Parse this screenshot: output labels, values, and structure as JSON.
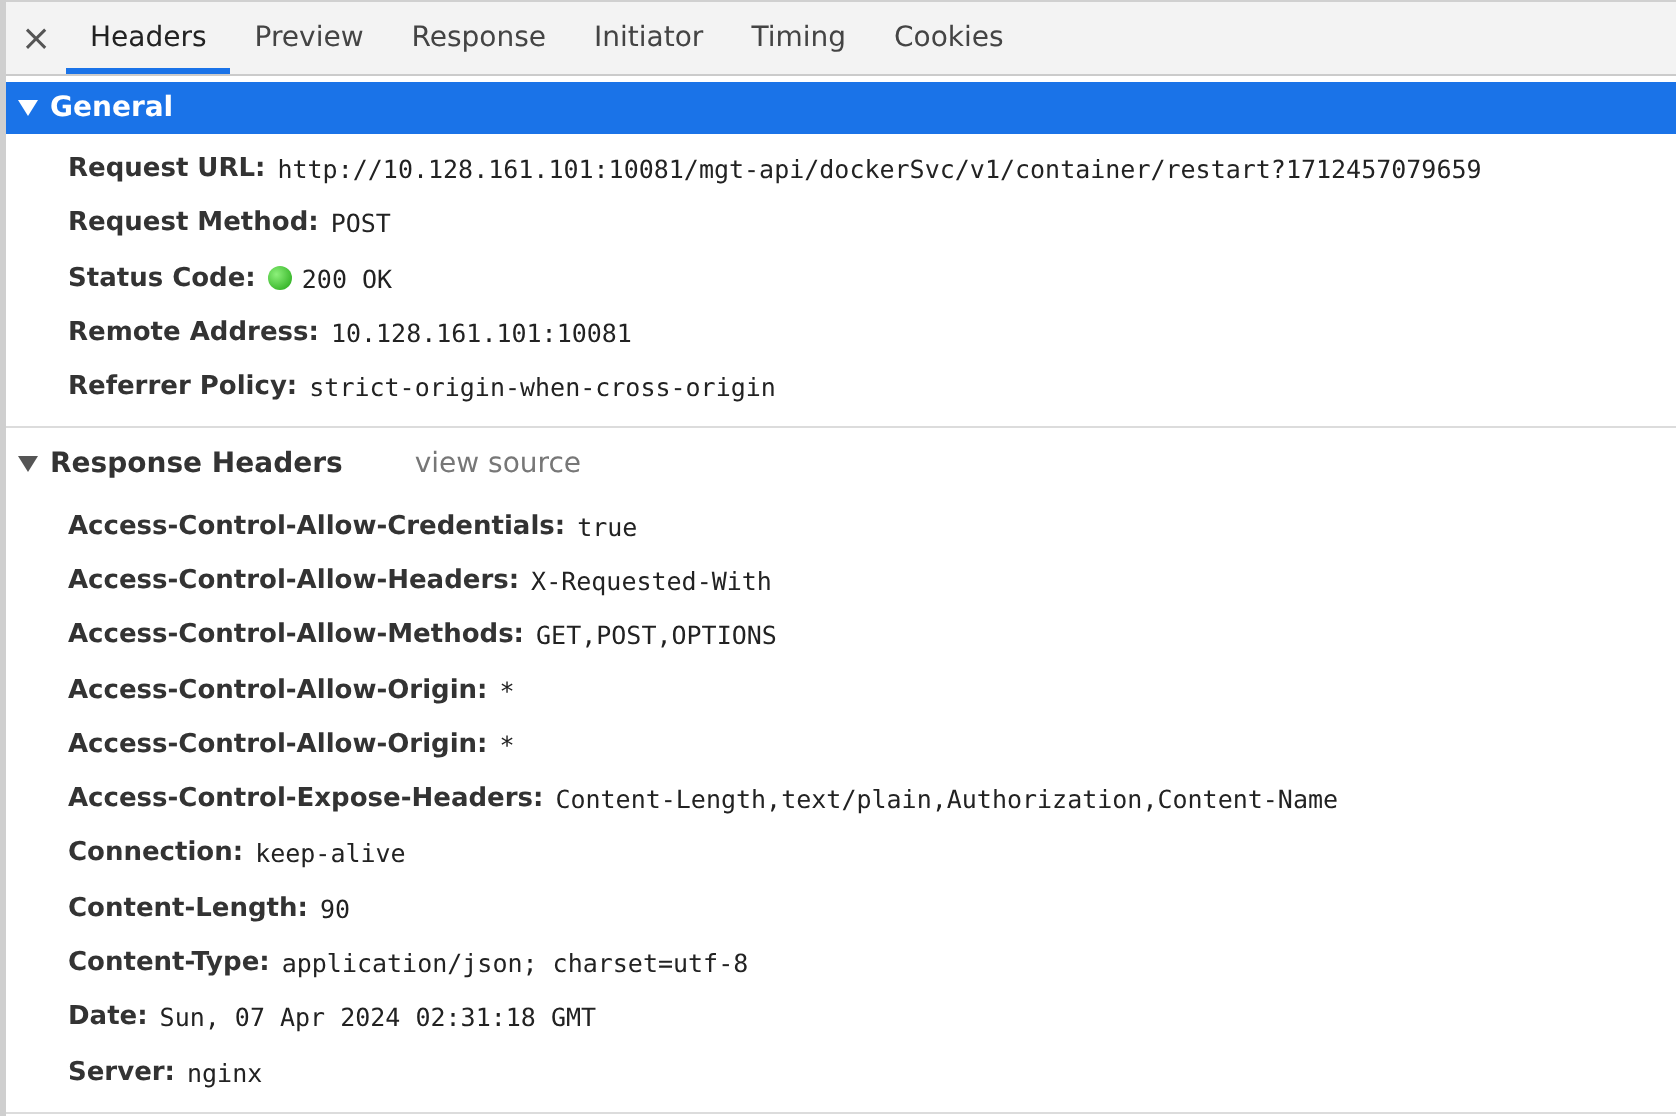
{
  "close_button": "×",
  "tabs": [
    {
      "label": "Headers",
      "selected": true
    },
    {
      "label": "Preview",
      "selected": false
    },
    {
      "label": "Response",
      "selected": false
    },
    {
      "label": "Initiator",
      "selected": false
    },
    {
      "label": "Timing",
      "selected": false
    },
    {
      "label": "Cookies",
      "selected": false
    }
  ],
  "sections": [
    {
      "title": "General",
      "expanded": true,
      "selected": true,
      "rows": [
        {
          "kind": "text",
          "name": "Request URL:",
          "value": "http://10.128.161.101:10081/mgt-api/dockerSvc/v1/container/restart?1712457079659"
        },
        {
          "kind": "text",
          "name": "Request Method:",
          "value": "POST"
        },
        {
          "kind": "status",
          "name": "Status Code:",
          "value": "200 OK"
        },
        {
          "kind": "text",
          "name": "Remote Address:",
          "value": "10.128.161.101:10081"
        },
        {
          "kind": "text",
          "name": "Referrer Policy:",
          "value": "strict-origin-when-cross-origin"
        }
      ]
    },
    {
      "title": "Response Headers",
      "link": "view source",
      "expanded": true,
      "selected": false,
      "rows": [
        {
          "kind": "text",
          "name": "Access-Control-Allow-Credentials:",
          "value": "true"
        },
        {
          "kind": "text",
          "name": "Access-Control-Allow-Headers:",
          "value": "X-Requested-With"
        },
        {
          "kind": "text",
          "name": "Access-Control-Allow-Methods:",
          "value": "GET,POST,OPTIONS"
        },
        {
          "kind": "text",
          "name": "Access-Control-Allow-Origin:",
          "value": "*"
        },
        {
          "kind": "text",
          "name": "Access-Control-Allow-Origin:",
          "value": "*"
        },
        {
          "kind": "text",
          "name": "Access-Control-Expose-Headers:",
          "value": "Content-Length,text/plain,Authorization,Content-Name"
        },
        {
          "kind": "text",
          "name": "Connection:",
          "value": "keep-alive"
        },
        {
          "kind": "text",
          "name": "Content-Length:",
          "value": "90"
        },
        {
          "kind": "text",
          "name": "Content-Type:",
          "value": "application/json; charset=utf-8"
        },
        {
          "kind": "text",
          "name": "Date:",
          "value": "Sun, 07 Apr 2024 02:31:18 GMT"
        },
        {
          "kind": "text",
          "name": "Server:",
          "value": "nginx"
        }
      ]
    }
  ]
}
